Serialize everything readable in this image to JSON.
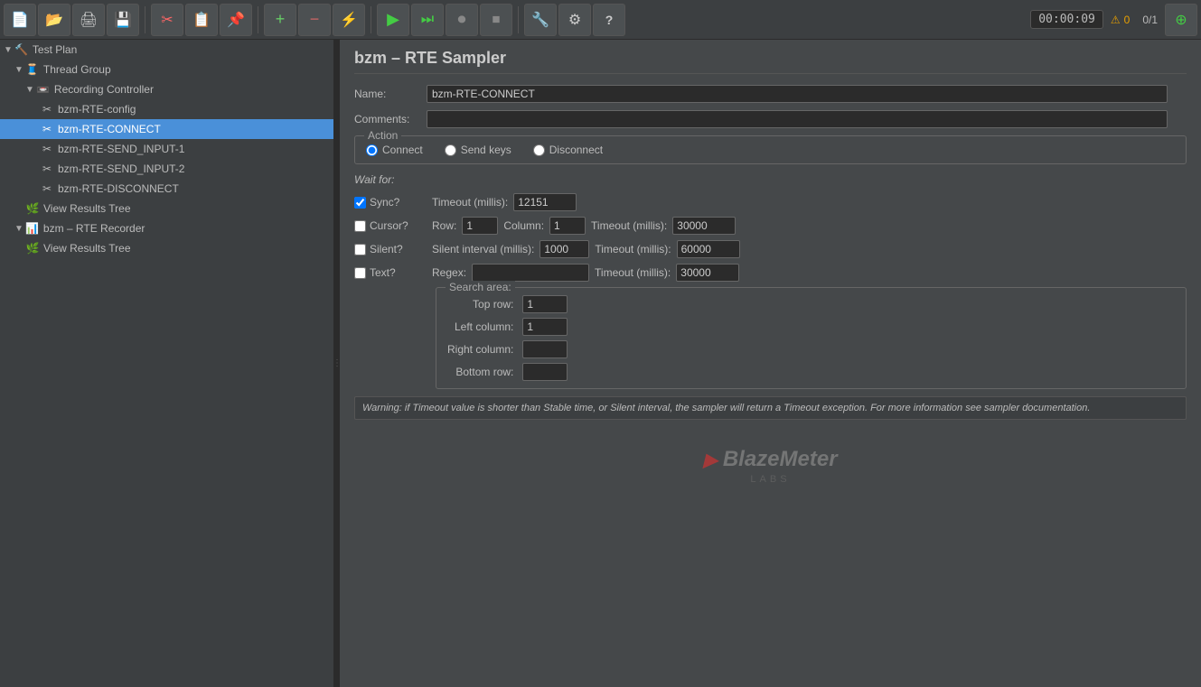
{
  "toolbar": {
    "buttons": [
      {
        "id": "new",
        "icon": "📄",
        "title": "New"
      },
      {
        "id": "open",
        "icon": "📂",
        "title": "Open"
      },
      {
        "id": "print",
        "icon": "🖨",
        "title": "Print"
      },
      {
        "id": "save",
        "icon": "💾",
        "title": "Save"
      },
      {
        "id": "cut",
        "icon": "✂",
        "title": "Cut"
      },
      {
        "id": "copy",
        "icon": "📋",
        "title": "Copy"
      },
      {
        "id": "paste",
        "icon": "📌",
        "title": "Paste"
      },
      {
        "id": "add",
        "icon": "➕",
        "title": "Add"
      },
      {
        "id": "remove",
        "icon": "➖",
        "title": "Remove"
      },
      {
        "id": "toggle",
        "icon": "⚡",
        "title": "Toggle"
      },
      {
        "id": "play",
        "icon": "▶",
        "title": "Start"
      },
      {
        "id": "start_no_pause",
        "icon": "⏭",
        "title": "Start no pause"
      },
      {
        "id": "stop",
        "icon": "⏺",
        "title": "Stop"
      },
      {
        "id": "stop_now",
        "icon": "⏹",
        "title": "Stop now"
      },
      {
        "id": "tools",
        "icon": "🔧",
        "title": "Tools"
      },
      {
        "id": "settings",
        "icon": "⚙",
        "title": "Settings"
      },
      {
        "id": "help",
        "icon": "?",
        "title": "Help"
      }
    ],
    "time": "00:00:09",
    "warning_icon": "⚠",
    "warning_count": "0",
    "counter": "0/1",
    "settings_icon": "⊕"
  },
  "sidebar": {
    "items": [
      {
        "id": "test-plan",
        "label": "Test Plan",
        "level": 0,
        "icon": "🔨",
        "collapsed": false,
        "type": "plan"
      },
      {
        "id": "thread-group",
        "label": "Thread Group",
        "level": 1,
        "icon": "🧵",
        "collapsed": false,
        "type": "thread"
      },
      {
        "id": "recording-controller",
        "label": "Recording Controller",
        "level": 2,
        "icon": "📼",
        "collapsed": false,
        "type": "controller"
      },
      {
        "id": "bzm-rte-config",
        "label": "bzm-RTE-config",
        "level": 3,
        "icon": "✂",
        "type": "config"
      },
      {
        "id": "bzm-rte-connect",
        "label": "bzm-RTE-CONNECT",
        "level": 3,
        "icon": "✂",
        "type": "sampler",
        "selected": true
      },
      {
        "id": "bzm-rte-send-input-1",
        "label": "bzm-RTE-SEND_INPUT-1",
        "level": 3,
        "icon": "✂",
        "type": "sampler"
      },
      {
        "id": "bzm-rte-send-input-2",
        "label": "bzm-RTE-SEND_INPUT-2",
        "level": 3,
        "icon": "✂",
        "type": "sampler"
      },
      {
        "id": "bzm-rte-disconnect",
        "label": "bzm-RTE-DISCONNECT",
        "level": 3,
        "icon": "✂",
        "type": "sampler"
      },
      {
        "id": "view-results-tree-1",
        "label": "View Results Tree",
        "level": 2,
        "icon": "🌿",
        "type": "listener"
      },
      {
        "id": "bzm-rte-recorder",
        "label": "bzm – RTE Recorder",
        "level": 1,
        "icon": "📊",
        "collapsed": false,
        "type": "recorder"
      },
      {
        "id": "view-results-tree-2",
        "label": "View Results Tree",
        "level": 2,
        "icon": "🌿",
        "type": "listener"
      }
    ]
  },
  "panel": {
    "title": "bzm – RTE Sampler",
    "name_label": "Name:",
    "name_value": "bzm-RTE-CONNECT",
    "comments_label": "Comments:",
    "action_group_label": "Action",
    "actions": [
      {
        "id": "connect",
        "label": "Connect",
        "selected": true
      },
      {
        "id": "send-keys",
        "label": "Send keys",
        "selected": false
      },
      {
        "id": "disconnect",
        "label": "Disconnect",
        "selected": false
      }
    ],
    "wait_for_label": "Wait for:",
    "sync": {
      "checkbox_label": "Sync?",
      "checked": true,
      "timeout_millis_label": "Timeout (millis):",
      "timeout_value": "12151"
    },
    "cursor": {
      "checkbox_label": "Cursor?",
      "checked": false,
      "row_label": "Row:",
      "row_value": "1",
      "column_label": "Column:",
      "column_value": "1",
      "timeout_millis_label": "Timeout (millis):",
      "timeout_value": "30000"
    },
    "silent": {
      "checkbox_label": "Silent?",
      "checked": false,
      "interval_label": "Silent interval (millis):",
      "interval_value": "1000",
      "timeout_millis_label": "Timeout (millis):",
      "timeout_value": "60000"
    },
    "text": {
      "checkbox_label": "Text?",
      "checked": false,
      "regex_label": "Regex:",
      "regex_value": "",
      "timeout_millis_label": "Timeout (millis):",
      "timeout_value": "30000"
    },
    "search_area": {
      "title": "Search area:",
      "top_row_label": "Top row:",
      "top_row_value": "1",
      "left_column_label": "Left column:",
      "left_column_value": "1",
      "right_column_label": "Right column:",
      "right_column_value": "",
      "bottom_row_label": "Bottom row:",
      "bottom_row_value": ""
    },
    "warning": "Warning: if Timeout value is shorter than Stable time, or Silent interval, the sampler will return a Timeout exception. For more information see sampler documentation."
  },
  "logo": {
    "text": "BlazeMeter",
    "sub": "LABS",
    "prefix": "bzm –"
  }
}
